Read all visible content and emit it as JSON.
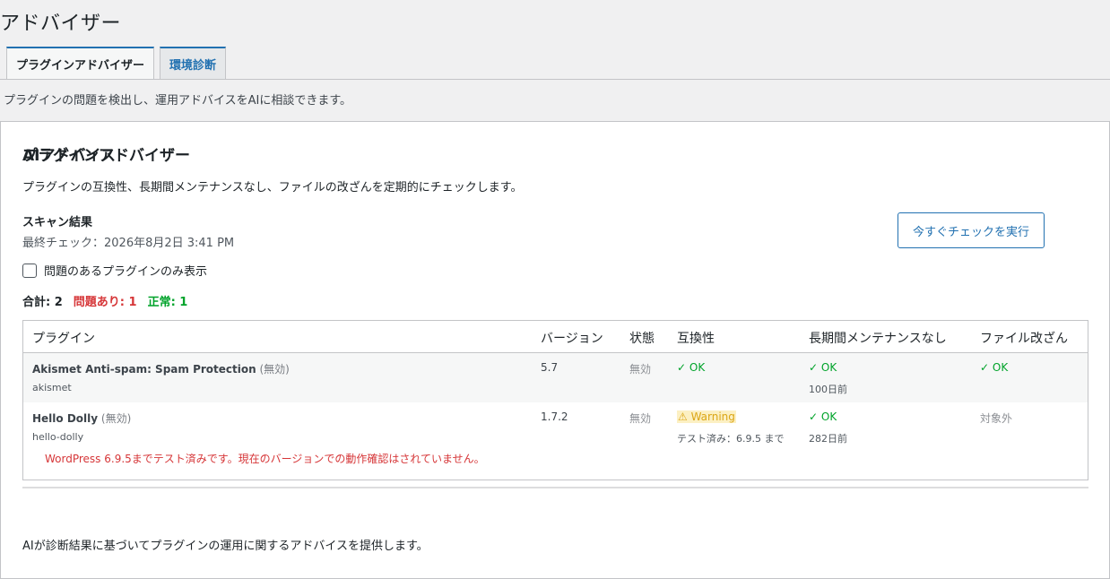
{
  "page": {
    "title": "アドバイザー",
    "subtitle": "プラグインの問題を検出し、運用アドバイスをAIに相談できます。"
  },
  "tabs": [
    {
      "label": "プラグインアドバイザー",
      "active": true
    },
    {
      "label": "環境診断",
      "active": false
    }
  ],
  "advisor": {
    "title": "プラグインアドバイザー",
    "description": "プラグインの互換性、長期間メンテナンスなし、ファイルの改ざんを定期的にチェックします。",
    "scan_title": "スキャン結果",
    "last_check": "最終チェック：2026年8月2日 3:41 PM",
    "run_button": "今すぐチェックを実行",
    "filter_label": "問題のあるプラグインのみ表示",
    "filter_checked": false,
    "summary": {
      "total": "合計: 2",
      "issues": "問題あり: 1",
      "normal": "正常: 1"
    }
  },
  "table": {
    "headers": [
      "プラグイン",
      "バージョン",
      "状態",
      "互換性",
      "長期間メンテナンスなし",
      "ファイル改ざん"
    ],
    "rows": [
      {
        "name": "Akismet Anti-spam: Spam Protection",
        "inactive_tag": "(無効)",
        "slug": "akismet",
        "version": "5.7",
        "status": "無効",
        "compat": "✓ OK",
        "compat_note": "",
        "maint": "✓ OK",
        "maint_note": "100日前",
        "tamper": "✓ OK"
      },
      {
        "name": "Hello Dolly",
        "inactive_tag": "(無効)",
        "slug": "hello-dolly",
        "version": "1.7.2",
        "status": "無効",
        "compat": "⚠ Warning",
        "compat_note": "テスト済み：6.9.5 まで",
        "maint": "✓ OK",
        "maint_note": "282日前",
        "tamper": "対象外",
        "message": "WordPress 6.9.5までテスト済みです。現在のバージョンでの動作確認はされていません。"
      }
    ]
  },
  "ai": {
    "title": "AIアドバイス",
    "description": "AIが診断結果に基づいてプラグインの運用に関するアドバイスを提供します。"
  },
  "colors": {
    "accent": "#2271b1",
    "ok": "#00a32a",
    "error": "#d63638",
    "warning": "#dba617"
  }
}
